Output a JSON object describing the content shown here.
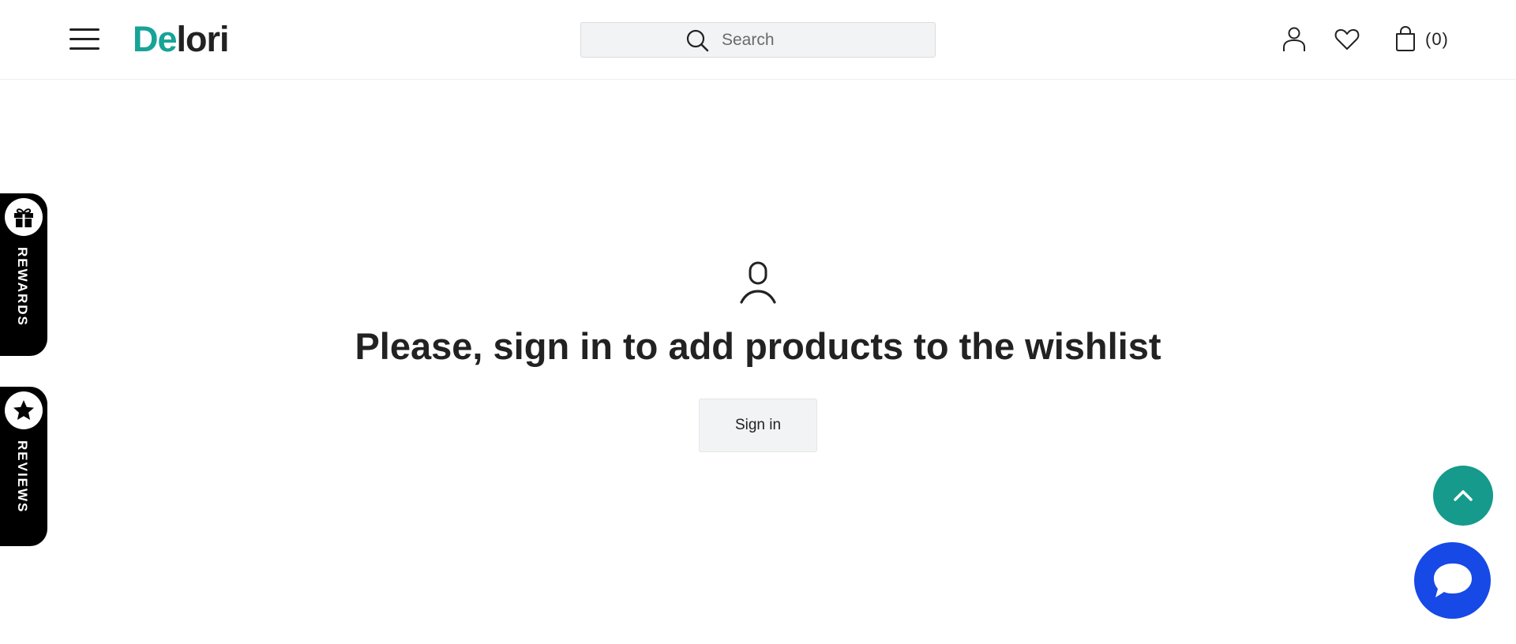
{
  "header": {
    "logo": {
      "accent": "De",
      "rest": "lori"
    },
    "search": {
      "placeholder": "Search"
    },
    "cart_count": "(0)"
  },
  "main": {
    "title": "Please, sign in to add products to the wishlist",
    "signin_label": "Sign in"
  },
  "side_tabs": {
    "rewards_label": "REWARDS",
    "reviews_label": "REVIEWS"
  },
  "colors": {
    "brand_teal": "#17a398",
    "scroll_top_bg": "#159a8c",
    "chat_bg": "#1749e6",
    "button_bg": "#f2f3f4"
  },
  "icons": [
    "menu-icon",
    "search-icon",
    "account-icon",
    "heart-icon",
    "bag-icon",
    "person-icon",
    "gift-icon",
    "star-icon",
    "chevron-up-icon",
    "chat-bubble-icon"
  ]
}
